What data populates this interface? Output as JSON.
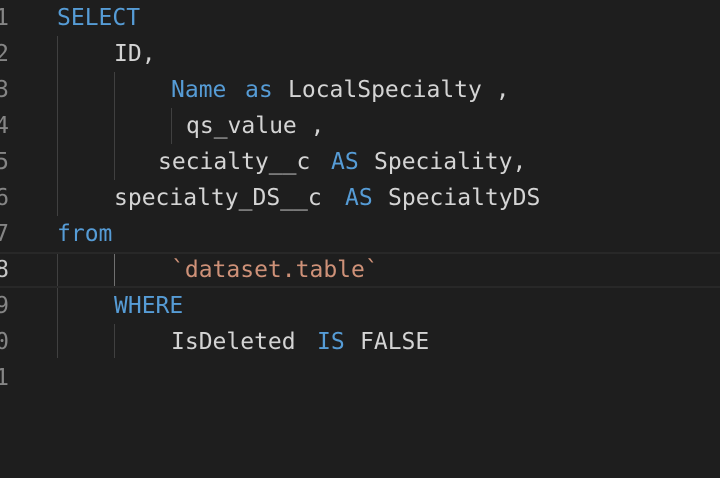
{
  "editor": {
    "line_numbers": [
      "1",
      "2",
      "3",
      "4",
      "5",
      "6",
      "7",
      "8",
      "9",
      "0",
      "1"
    ],
    "lines": [
      {
        "tokens": [
          {
            "text": "SELECT",
            "type": "kw"
          }
        ]
      },
      {
        "tokens": [
          {
            "text": "ID,",
            "type": "id"
          }
        ]
      },
      {
        "tokens": [
          {
            "text": "Name",
            "type": "kw"
          },
          {
            "text": "as",
            "type": "kw"
          },
          {
            "text": "LocalSpecialty ,",
            "type": "id"
          }
        ]
      },
      {
        "tokens": [
          {
            "text": "qs_value ,",
            "type": "id"
          }
        ]
      },
      {
        "tokens": [
          {
            "text": "secialty__c",
            "type": "id"
          },
          {
            "text": "AS",
            "type": "kw"
          },
          {
            "text": "Speciality,",
            "type": "id"
          }
        ]
      },
      {
        "tokens": [
          {
            "text": "specialty_DS__c",
            "type": "id"
          },
          {
            "text": "AS",
            "type": "kw"
          },
          {
            "text": "SpecialtyDS",
            "type": "id"
          }
        ]
      },
      {
        "tokens": [
          {
            "text": "from",
            "type": "kw"
          }
        ]
      },
      {
        "tokens": [
          {
            "text": "`dataset.table`",
            "type": "str"
          }
        ]
      },
      {
        "tokens": [
          {
            "text": "WHERE",
            "type": "kw"
          }
        ]
      },
      {
        "tokens": [
          {
            "text": "IsDeleted",
            "type": "id"
          },
          {
            "text": "IS",
            "type": "kw"
          },
          {
            "text": "FALSE",
            "type": "id"
          }
        ]
      }
    ]
  },
  "colors": {
    "background": "#1e1e1e",
    "keyword": "#569cd6",
    "identifier": "#d4d4d4",
    "string": "#ce9178",
    "line_number": "#858585"
  }
}
